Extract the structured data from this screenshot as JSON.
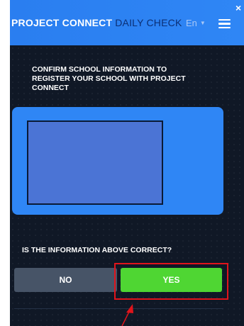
{
  "header": {
    "brand_main": "PROJECT CONNECT",
    "brand_sub": "DAILY CHECK",
    "language": "En",
    "language_caret_icon": "chevron-down-icon",
    "menu_icon": "hamburger-menu-icon",
    "close_icon": "close-icon",
    "close_glyph": "×"
  },
  "main": {
    "instructions": "CONFIRM SCHOOL INFORMATION TO REGISTER YOUR SCHOOL WITH PROJECT CONNECT",
    "question": "IS THE INFORMATION ABOVE CORRECT?",
    "no_label": "NO",
    "yes_label": "YES"
  },
  "colors": {
    "header_bg": "#2f86f5",
    "app_bg": "#101826",
    "card_bg": "#2f86f5",
    "no_button": "#475467",
    "yes_button": "#4fd633",
    "highlight": "#e0141b"
  }
}
